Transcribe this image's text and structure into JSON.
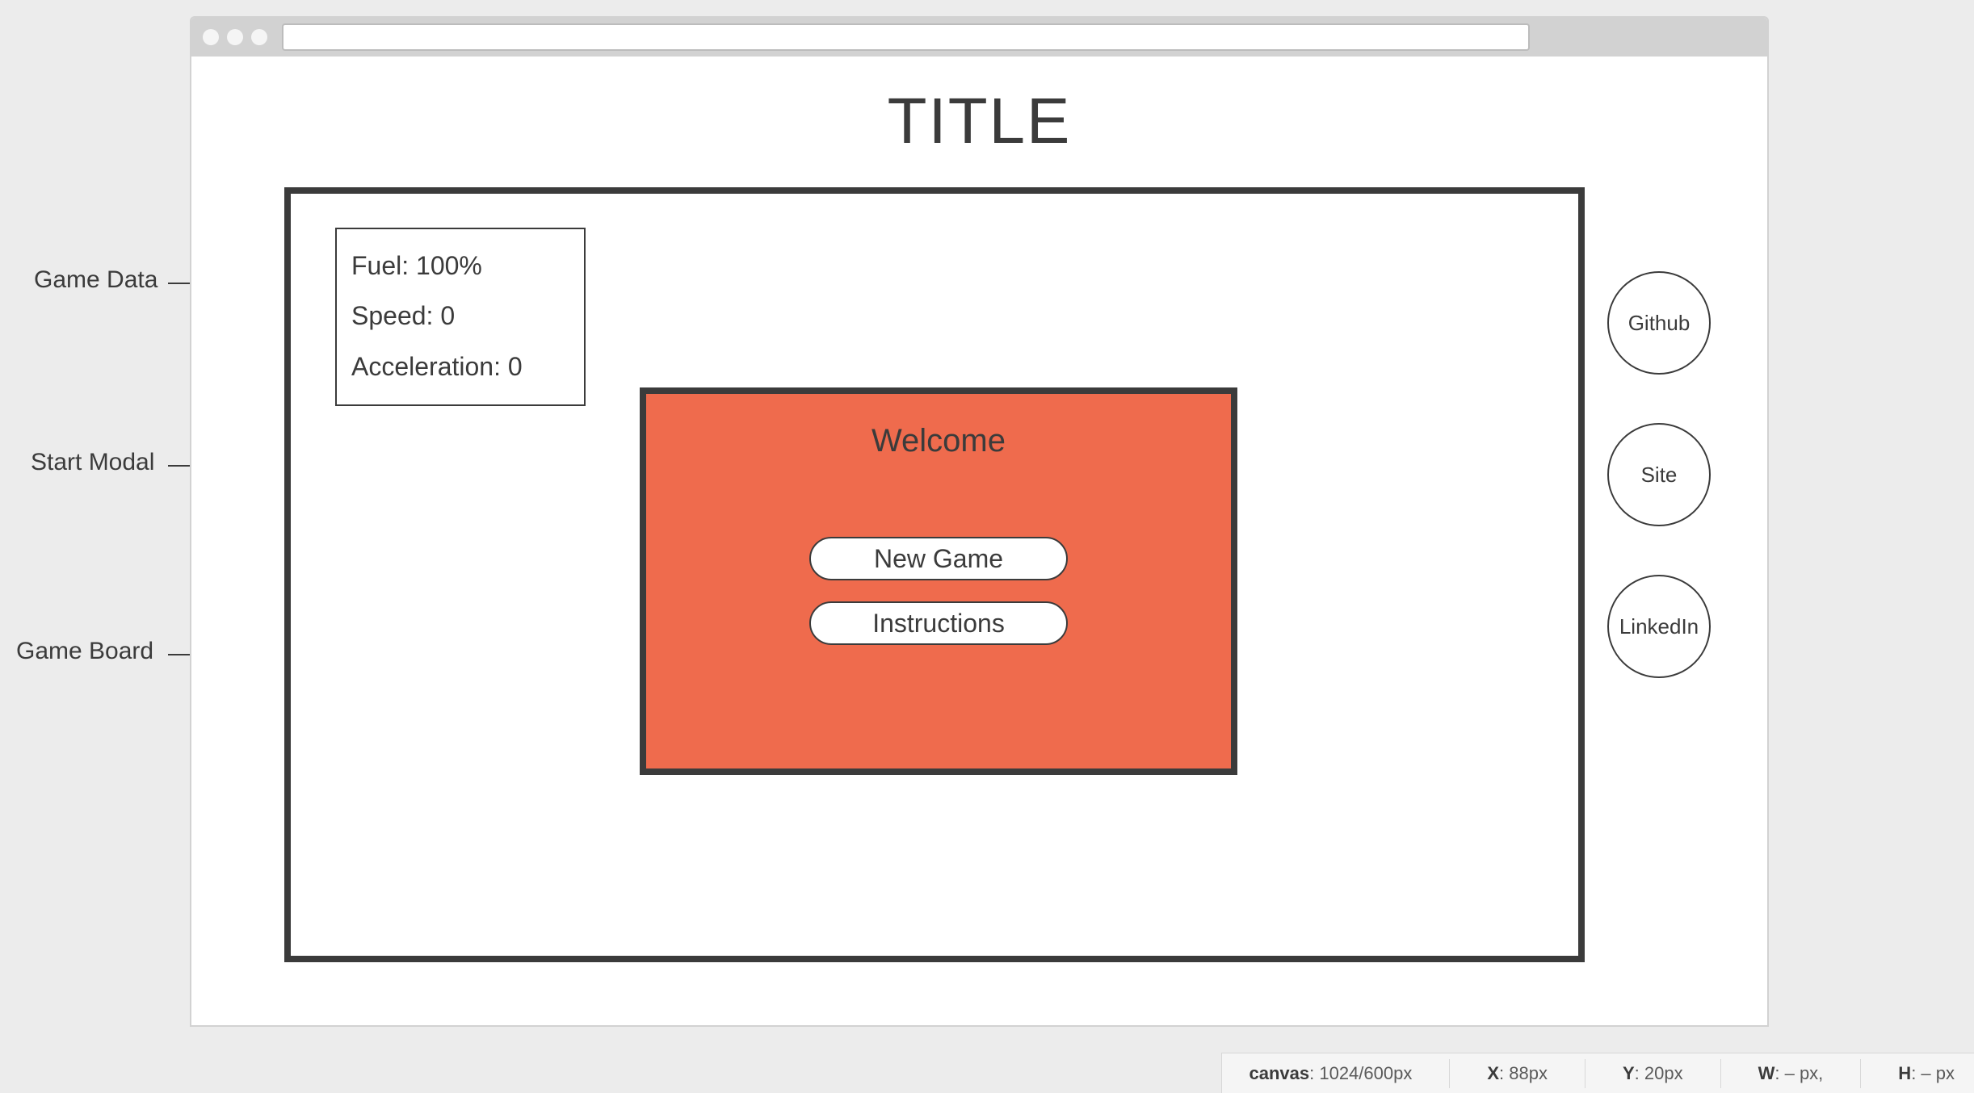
{
  "page": {
    "title": "TITLE"
  },
  "annotations": {
    "game_data": "Game Data",
    "start_modal": "Start Modal",
    "game_board": "Game Board"
  },
  "game_data": {
    "fuel": "Fuel: 100%",
    "speed": "Speed: 0",
    "accel": "Acceleration: 0"
  },
  "modal": {
    "title": "Welcome",
    "new_game": "New Game",
    "instructions": "Instructions"
  },
  "links": {
    "github": "Github",
    "site": "Site",
    "linkedin": "LinkedIn"
  },
  "status": {
    "canvas_label": "canvas",
    "canvas_value": ": 1024/600px",
    "x_label": "X",
    "x_value": ": 88px",
    "y_label": "Y",
    "y_value": ": 20px",
    "w_label": "W",
    "w_value": ": – px,",
    "h_label": "H",
    "h_value": ": – px"
  }
}
